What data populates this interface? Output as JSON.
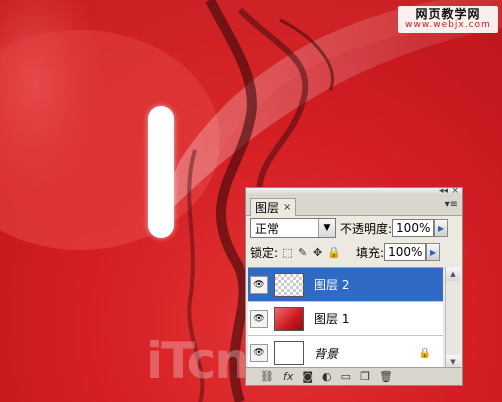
{
  "watermark": {
    "title": "网页教学网",
    "url": "www.webjx.com"
  },
  "canvas_watermark": "iTcn.cn",
  "panel": {
    "tab_label": "图层",
    "close_glyph": "×",
    "menu_glyph": "▾≡",
    "titlebar_buttons": "◂◂ ×",
    "blend_mode": "正常",
    "opacity_label": "不透明度:",
    "opacity_value": "100%",
    "lock_label": "锁定:",
    "fill_label": "填充:",
    "fill_value": "100%",
    "layers": [
      {
        "name": "图层 2",
        "selected": true,
        "thumbnail": "transparent"
      },
      {
        "name": "图层 1",
        "selected": false,
        "thumbnail": "red-image"
      },
      {
        "name": "背景",
        "selected": false,
        "thumbnail": "white",
        "locked": true
      }
    ],
    "bottom_icons": [
      "link-icon",
      "fx-icon",
      "mask-icon",
      "adjustment-icon",
      "folder-icon",
      "new-layer-icon",
      "trash-icon"
    ]
  },
  "colors": {
    "background_red": "#d41e24",
    "selected_layer": "#316ac5",
    "panel_bg": "#ece9e0"
  }
}
